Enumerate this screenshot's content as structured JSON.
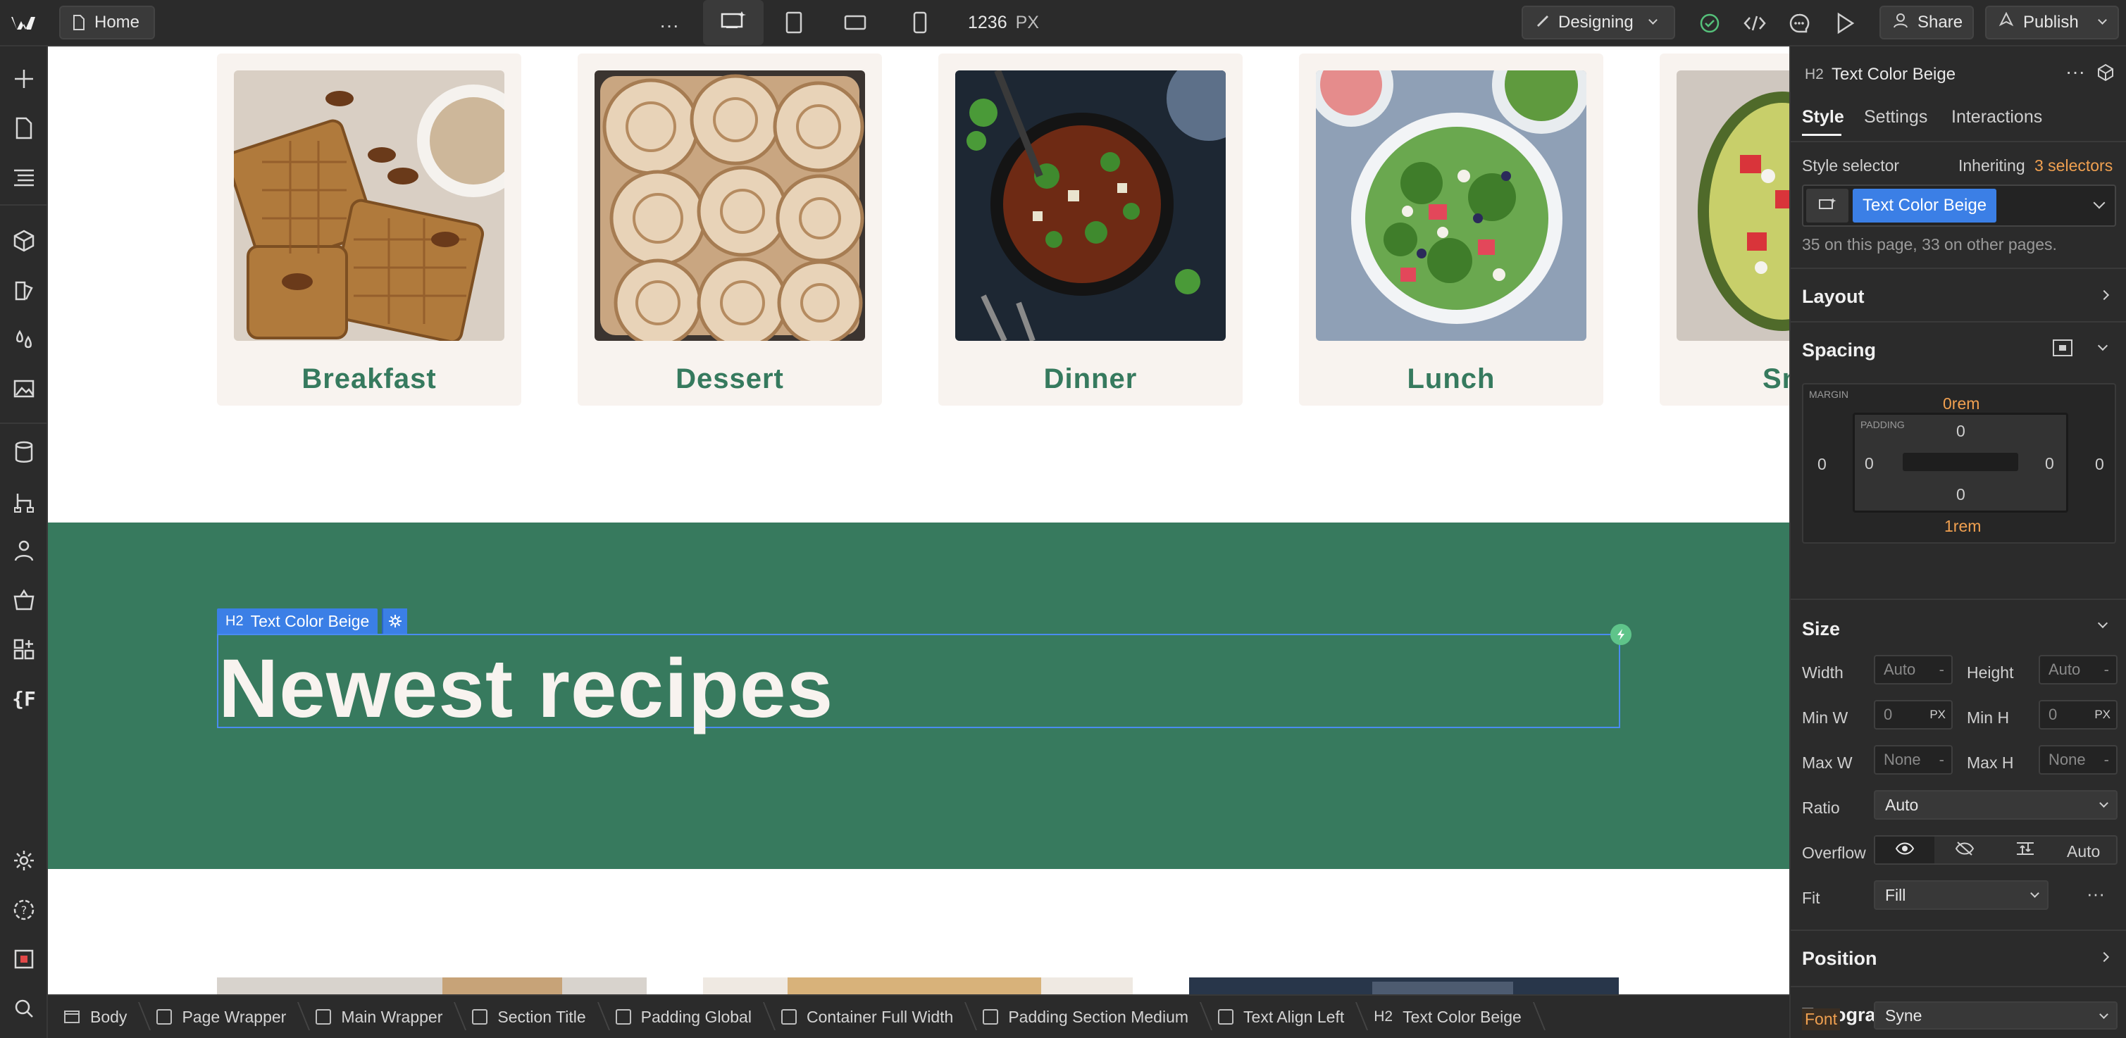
{
  "topbar": {
    "page_name": "Home",
    "width_value": "1236",
    "width_unit": "PX",
    "mode_label": "Designing",
    "share_label": "Share",
    "publish_label": "Publish"
  },
  "canvas": {
    "categories": [
      "Breakfast",
      "Dessert",
      "Dinner",
      "Lunch",
      "Sn"
    ],
    "section_heading": "Newest recipes",
    "selection_tag": {
      "tag": "H2",
      "class_name": "Text Color Beige"
    }
  },
  "breadcrumb": [
    {
      "label": "Body"
    },
    {
      "label": "Page Wrapper"
    },
    {
      "label": "Main Wrapper"
    },
    {
      "label": "Section Title"
    },
    {
      "label": "Padding Global"
    },
    {
      "label": "Container Full Width"
    },
    {
      "label": "Padding Section Medium"
    },
    {
      "label": "Text Align Left"
    },
    {
      "label": "Text Color Beige",
      "tag": "H2"
    }
  ],
  "panel": {
    "element_tag": "H2",
    "element_name": "Text Color Beige",
    "tabs": [
      "Style",
      "Settings",
      "Interactions"
    ],
    "style_selector_label": "Style selector",
    "inheriting_label": "Inheriting",
    "inheriting_count": "3 selectors",
    "selector_chip": "Text Color Beige",
    "usage_text": "35 on this page, 33 on other pages.",
    "layout_title": "Layout",
    "spacing": {
      "title": "Spacing",
      "margin_label": "MARGIN",
      "padding_label": "PADDING",
      "margin_top": "0rem",
      "margin_bottom": "1rem",
      "margin_left": "0",
      "margin_right": "0",
      "padding_top": "0",
      "padding_bottom": "0",
      "padding_left": "0",
      "padding_right": "0"
    },
    "size": {
      "title": "Size",
      "width_label": "Width",
      "width_value": "Auto",
      "height_label": "Height",
      "height_value": "Auto",
      "minw_label": "Min W",
      "minw_value": "0",
      "minw_unit": "PX",
      "minh_label": "Min H",
      "minh_value": "0",
      "minh_unit": "PX",
      "maxw_label": "Max W",
      "maxw_value": "None",
      "maxh_label": "Max H",
      "maxh_value": "None",
      "unit_dash": "-",
      "ratio_label": "Ratio",
      "ratio_value": "Auto",
      "overflow_label": "Overflow",
      "overflow_auto": "Auto",
      "fit_label": "Fit",
      "fit_value": "Fill"
    },
    "position_title": "Position",
    "typography": {
      "title": "Typography",
      "font_label": "Font",
      "font_value": "Syne"
    }
  },
  "colors": {
    "accent": "#3b7fe6",
    "green": "#377a5e",
    "beige": "#f8f3ef",
    "orange": "#f0a050"
  }
}
